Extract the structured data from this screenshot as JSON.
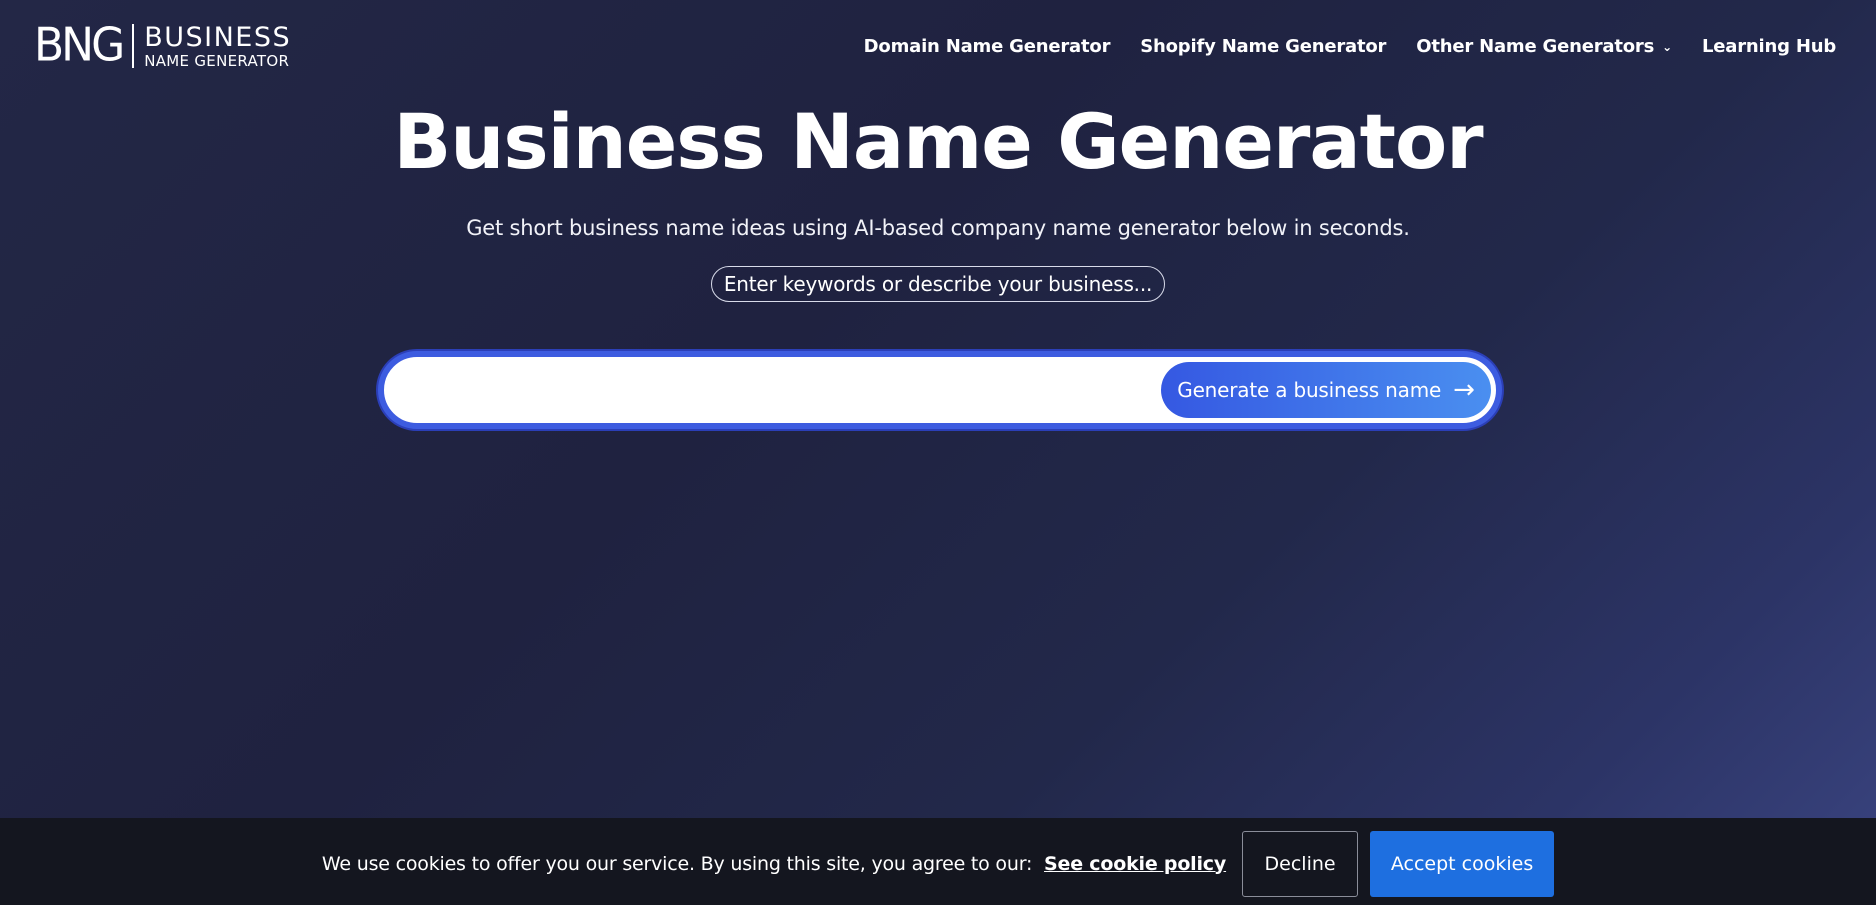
{
  "header": {
    "logo": {
      "mark": "BNG",
      "line1": "BUSINESS",
      "line2": "NAME GENERATOR"
    },
    "nav": [
      {
        "label": "Domain Name Generator"
      },
      {
        "label": "Shopify Name Generator"
      },
      {
        "label": "Other Name Generators",
        "icon": "chevron-down-icon"
      },
      {
        "label": "Learning Hub"
      }
    ]
  },
  "hero": {
    "title": "Business Name Generator",
    "subtitle": "Get short business name ideas using AI-based company name generator below in seconds.",
    "hint": "Enter keywords or describe your business...",
    "search": {
      "value": "",
      "placeholder": ""
    },
    "generate_button": {
      "label": "Generate a business name",
      "icon": "arrow-right-icon"
    }
  },
  "cookie_bar": {
    "text": "We use cookies to offer you our service. By using this site, you agree to our:",
    "link": "See cookie policy",
    "decline": "Decline",
    "accept": "Accept cookies"
  },
  "colors": {
    "background": "#232746",
    "accent": "#3d5ce0",
    "button_gradient_start": "#3558e2",
    "button_gradient_end": "#4a8ff0",
    "accept": "#1e6fe0",
    "cookie_bar": "#14161f"
  }
}
